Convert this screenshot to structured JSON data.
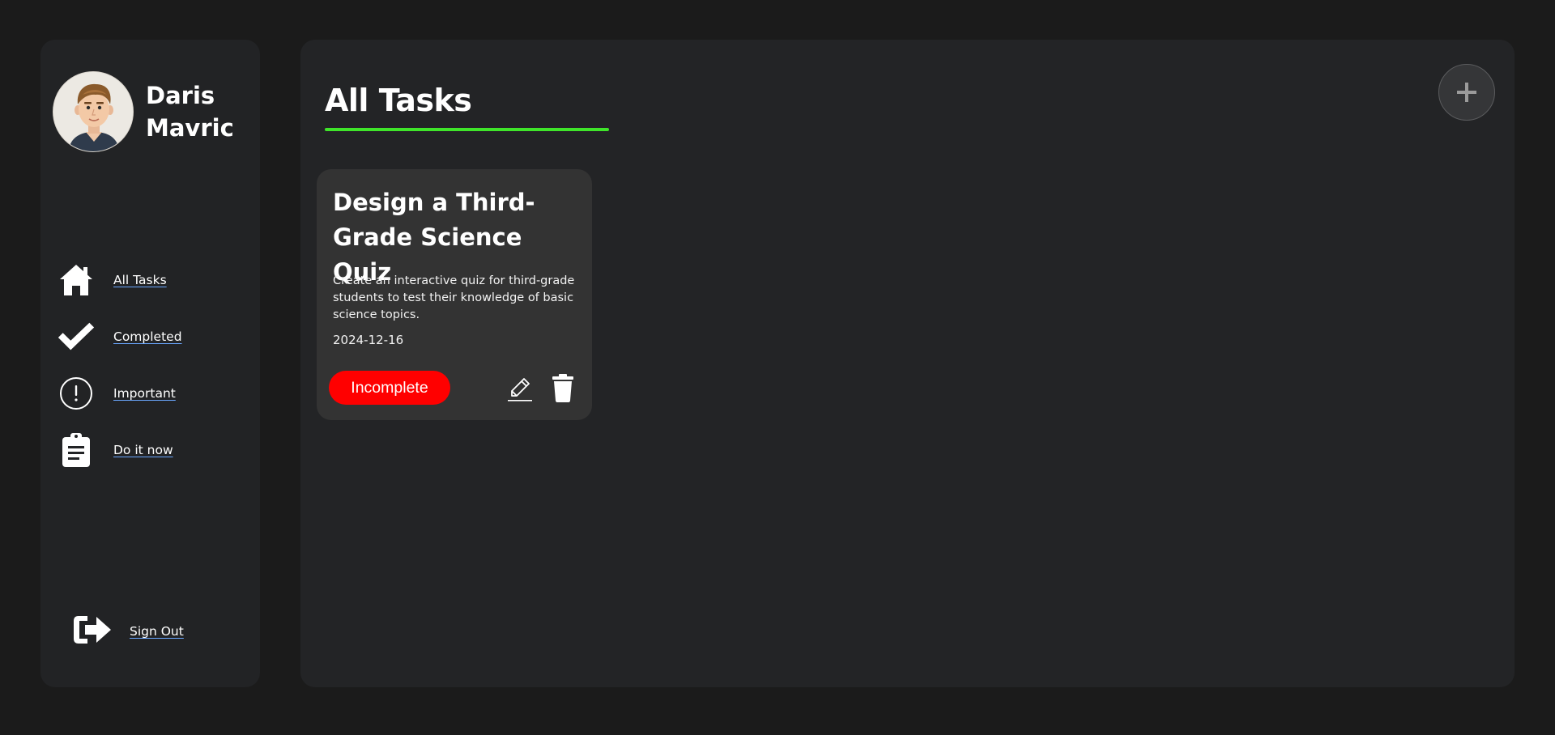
{
  "user": {
    "name": "Daris Mavric"
  },
  "sidebar": {
    "items": [
      {
        "label": "All Tasks",
        "icon": "home-icon"
      },
      {
        "label": "Completed",
        "icon": "check-icon"
      },
      {
        "label": "Important",
        "icon": "exclamation-circle-icon"
      },
      {
        "label": "Do it now",
        "icon": "clipboard-icon"
      }
    ],
    "signout_label": "Sign Out",
    "signout_icon": "sign-out-icon"
  },
  "main": {
    "title": "All Tasks",
    "add_icon": "plus-icon",
    "tasks": [
      {
        "title": "Design a Third-Grade Science Quiz",
        "description": "Create an interactive quiz for third-grade students to test their knowledge of basic science topics.",
        "date": "2024-12-16",
        "status": "Incomplete",
        "edit_icon": "pencil-icon",
        "delete_icon": "trash-icon"
      }
    ]
  },
  "colors": {
    "background": "#1b1b1b",
    "panel": "#232426",
    "card": "#333333",
    "accent_underline": "#3fe52a",
    "status_incomplete": "#ff0000",
    "link_underline": "#6aa7ff"
  }
}
